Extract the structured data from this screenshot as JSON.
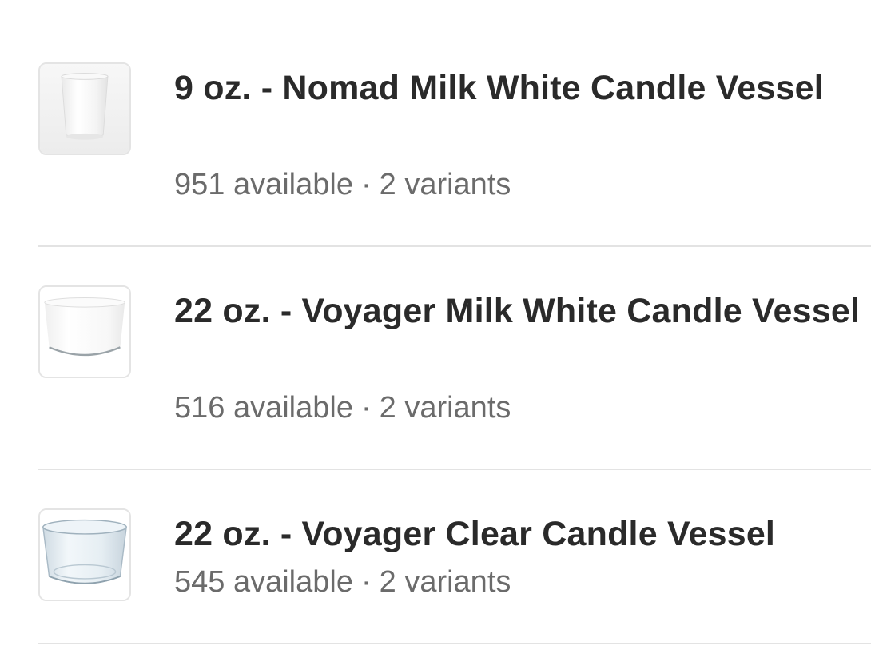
{
  "products": [
    {
      "title": "9 oz. - Nomad Milk White Candle Vessel",
      "available": "951 available",
      "separator": "·",
      "variants": "2 variants",
      "thumbnail_icon": "milk-white-tumbler-icon"
    },
    {
      "title": "22 oz. - Voyager Milk White Candle Vessel",
      "available": "516 available",
      "separator": "·",
      "variants": "2 variants",
      "thumbnail_icon": "milk-white-bowl-icon"
    },
    {
      "title": "22 oz. - Voyager Clear Candle Vessel",
      "available": "545 available",
      "separator": "·",
      "variants": "2 variants",
      "thumbnail_icon": "clear-glass-bowl-icon"
    }
  ],
  "colors": {
    "title_text": "#2a2a2a",
    "meta_text": "#6b6b6b",
    "divider": "#e3e3e3",
    "thumbnail_border": "#e4e4e4"
  }
}
